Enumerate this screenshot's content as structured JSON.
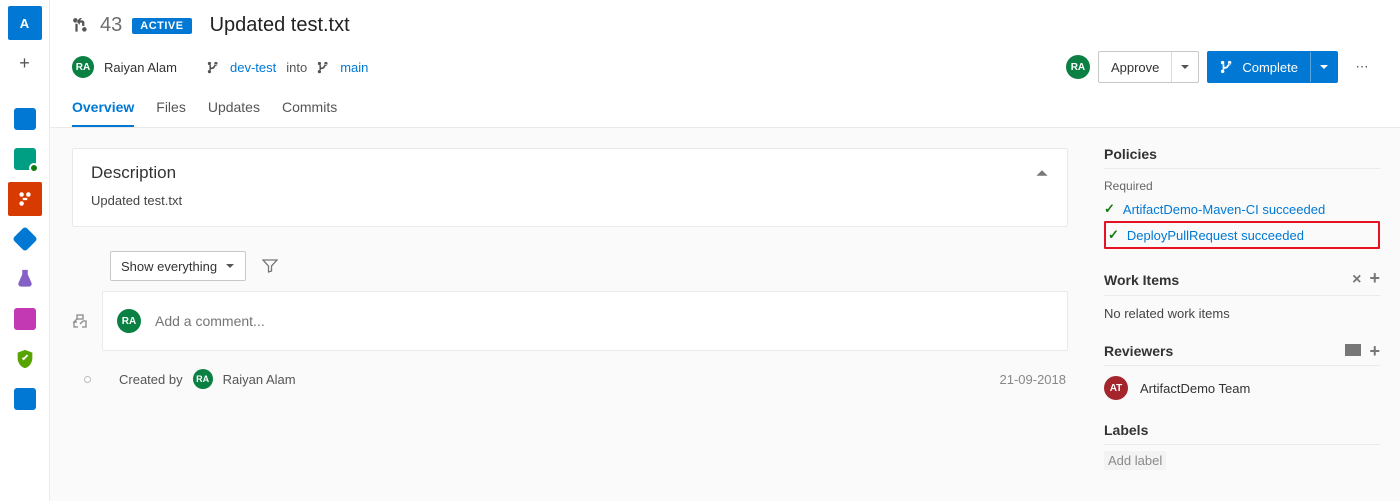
{
  "rail": {
    "project_initial": "A"
  },
  "pr": {
    "number": "43",
    "status": "ACTIVE",
    "title": "Updated test.txt"
  },
  "author": {
    "initials": "RA",
    "name": "Raiyan Alam"
  },
  "branches": {
    "source": "dev-test",
    "into": "into",
    "target": "main"
  },
  "actions": {
    "approve": "Approve",
    "complete": "Complete",
    "approver_initials": "RA"
  },
  "tabs": {
    "overview": "Overview",
    "files": "Files",
    "updates": "Updates",
    "commits": "Commits"
  },
  "description": {
    "heading": "Description",
    "text": "Updated test.txt"
  },
  "timeline": {
    "filter_label": "Show everything",
    "comment_placeholder": "Add a comment...",
    "created_by_prefix": "Created by",
    "created_by_name": "Raiyan Alam",
    "created_by_initials": "RA",
    "created_date": "21-09-2018"
  },
  "right": {
    "policies_heading": "Policies",
    "required_label": "Required",
    "policies": [
      {
        "name": "ArtifactDemo-Maven-CI succeeded"
      },
      {
        "name": "DeployPullRequest succeeded"
      }
    ],
    "workitems_heading": "Work Items",
    "workitems_empty": "No related work items",
    "reviewers_heading": "Reviewers",
    "reviewer": {
      "initials": "AT",
      "name": "ArtifactDemo Team"
    },
    "labels_heading": "Labels",
    "labels_add": "Add label"
  }
}
